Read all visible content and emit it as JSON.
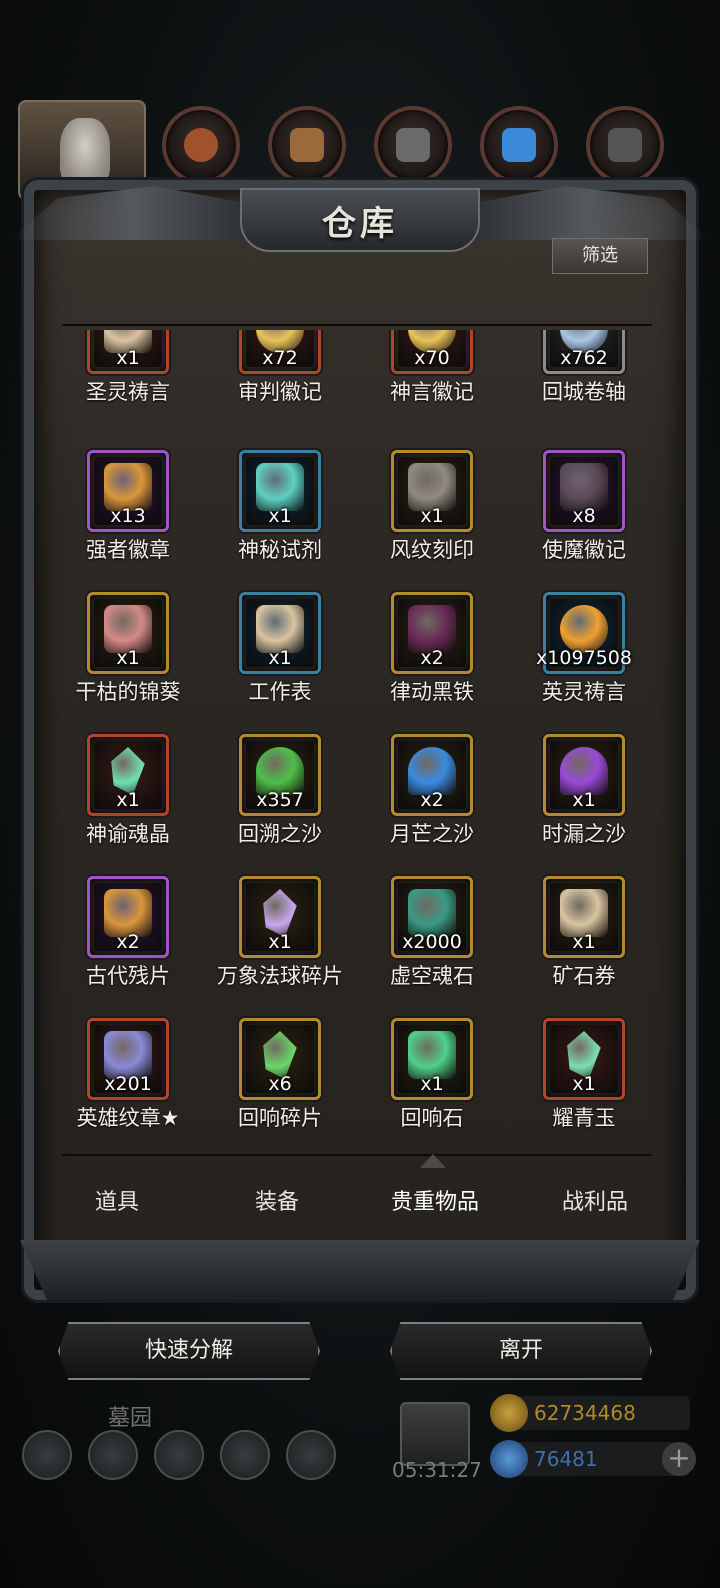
{
  "panel": {
    "title": "仓库",
    "filter_label": "筛选"
  },
  "items": [
    {
      "name": "圣灵祷言",
      "qty": "x1",
      "frame": "#b2442b",
      "bg": "#3a1b15",
      "icon": "scroll-icon",
      "color": "#d9c4a0"
    },
    {
      "name": "审判徽记",
      "qty": "x72",
      "frame": "#b2442b",
      "bg": "#3a1b15",
      "icon": "gold-emblem-icon",
      "color": "#e8c45a"
    },
    {
      "name": "神言徽记",
      "qty": "x70",
      "frame": "#b2442b",
      "bg": "#3a1b15",
      "icon": "gold-emblem-icon",
      "color": "#e8c45a"
    },
    {
      "name": "回城卷轴",
      "qty": "x762",
      "frame": "#8a8c8e",
      "bg": "#2a2b2c",
      "icon": "swirl-scroll-icon",
      "color": "#a9c7e8"
    },
    {
      "name": "强者徽章",
      "qty": "x13",
      "frame": "#a054c8",
      "bg": "#2d1438",
      "icon": "badge-icon",
      "color": "#d9973a"
    },
    {
      "name": "神秘试剂",
      "qty": "x1",
      "frame": "#3c7fa3",
      "bg": "#10283a",
      "icon": "potion-icon",
      "color": "#5fd0c0"
    },
    {
      "name": "风纹刻印",
      "qty": "x1",
      "frame": "#b48a2e",
      "bg": "#2e2410",
      "icon": "stone-tablet-icon",
      "color": "#8f8a82"
    },
    {
      "name": "使魔徽记",
      "qty": "x8",
      "frame": "#a054c8",
      "bg": "#2d1438",
      "icon": "dark-seal-icon",
      "color": "#5a4a55"
    },
    {
      "name": "干枯的锦葵",
      "qty": "x1",
      "frame": "#b48a2e",
      "bg": "#2e2410",
      "icon": "flower-icon",
      "color": "#d48a86"
    },
    {
      "name": "工作表",
      "qty": "x1",
      "frame": "#3c7fa3",
      "bg": "#10283a",
      "icon": "paper-icon",
      "color": "#d9c4a0"
    },
    {
      "name": "律动黑铁",
      "qty": "x2",
      "frame": "#b48a2e",
      "bg": "#2e2410",
      "icon": "ingot-icon",
      "color": "#6a2b58"
    },
    {
      "name": "英灵祷言",
      "qty": "x1097508",
      "frame": "#3c7fa3",
      "bg": "#10283a",
      "icon": "fire-orb-icon",
      "color": "#f0a030"
    },
    {
      "name": "神谕魂晶",
      "qty": "x1",
      "frame": "#b2442b",
      "bg": "#3a1b15",
      "icon": "crystal-icon",
      "color": "#6fe0b0"
    },
    {
      "name": "回溯之沙",
      "qty": "x357",
      "frame": "#b48a2e",
      "bg": "#2e2410",
      "icon": "green-sand-icon",
      "color": "#4fc04a"
    },
    {
      "name": "月芒之沙",
      "qty": "x2",
      "frame": "#b48a2e",
      "bg": "#2e2410",
      "icon": "blue-sand-icon",
      "color": "#3a8ae0"
    },
    {
      "name": "时漏之沙",
      "qty": "x1",
      "frame": "#b48a2e",
      "bg": "#2e2410",
      "icon": "purple-sand-icon",
      "color": "#9a4ad8"
    },
    {
      "name": "古代残片",
      "qty": "x2",
      "frame": "#a054c8",
      "bg": "#2d1438",
      "icon": "fragment-icon",
      "color": "#d9973a"
    },
    {
      "name": "万象法球碎片",
      "qty": "x1",
      "frame": "#b48a2e",
      "bg": "#2e2410",
      "icon": "violet-shard-icon",
      "color": "#c9a8f0"
    },
    {
      "name": "虚空魂石",
      "qty": "x2000",
      "frame": "#b48a2e",
      "bg": "#2e2410",
      "icon": "soul-stone-icon",
      "color": "#3a9a86"
    },
    {
      "name": "矿石券",
      "qty": "x1",
      "frame": "#b48a2e",
      "bg": "#2e2410",
      "icon": "voucher-icon",
      "color": "#d9c4a0"
    },
    {
      "name": "英雄纹章★",
      "qty": "x201",
      "frame": "#b2442b",
      "bg": "#3a1b15",
      "icon": "crest-icon",
      "color": "#8a8ad8"
    },
    {
      "name": "回响碎片",
      "qty": "x6",
      "frame": "#b48a2e",
      "bg": "#2e2410",
      "icon": "green-shard-icon",
      "color": "#6ad86a"
    },
    {
      "name": "回响石",
      "qty": "x1",
      "frame": "#b48a2e",
      "bg": "#2e2410",
      "icon": "green-cluster-icon",
      "color": "#4fd08a"
    },
    {
      "name": "耀青玉",
      "qty": "x1",
      "frame": "#b2442b",
      "bg": "#3a1b15",
      "icon": "jade-icon",
      "color": "#7ae0b0"
    }
  ],
  "tabs": [
    "道具",
    "装备",
    "贵重物品",
    "战利品"
  ],
  "active_tab": "贵重物品",
  "buttons": {
    "decompose": "快速分解",
    "leave": "离开"
  },
  "hud": {
    "location": "墓园",
    "timer": "05:31:27",
    "gold": "62734468",
    "gems": "76481",
    "plus": "+"
  },
  "colors": {
    "gold_text": "#b08a2a",
    "gem_text": "#3d6fa8"
  }
}
